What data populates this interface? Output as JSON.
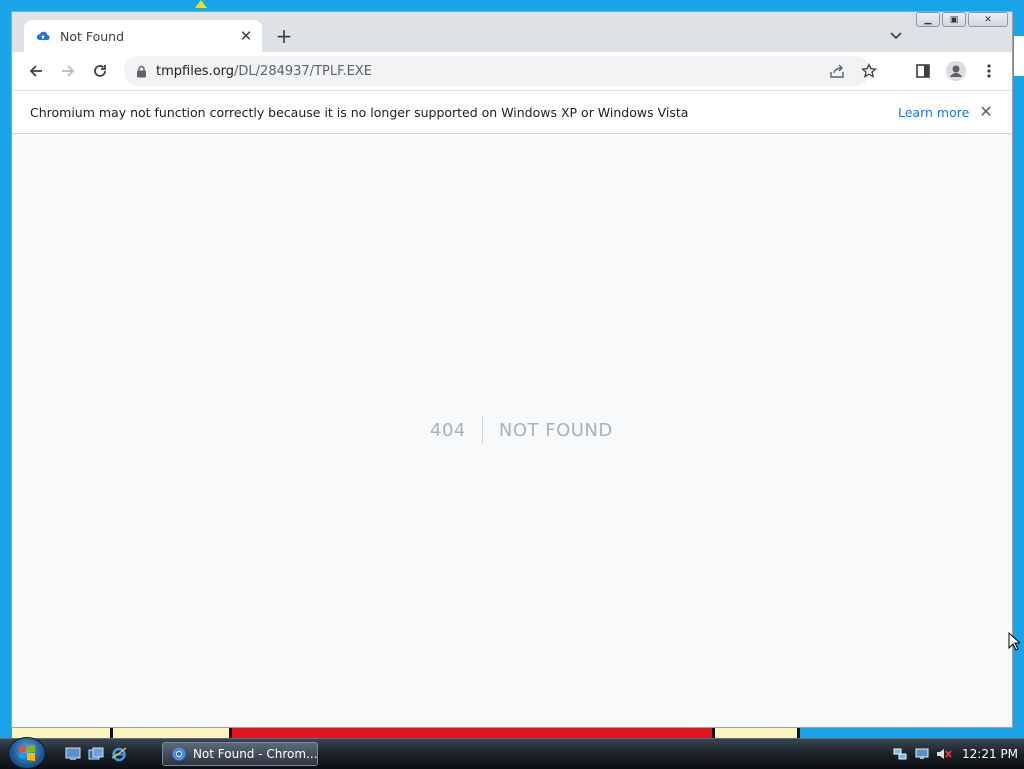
{
  "browser": {
    "tab": {
      "title": "Not Found"
    },
    "address_bar": {
      "domain": "tmpfiles.org",
      "path": "/DL/284937/TPLF.EXE"
    },
    "infobar": {
      "message": "Chromium may not function correctly because it is no longer supported on Windows XP or Windows Vista",
      "link": "Learn more"
    }
  },
  "page": {
    "error_code": "404",
    "error_text": "NOT FOUND"
  },
  "taskbar": {
    "task_label": "Not Found - Chrom...",
    "clock": "12:21 PM"
  },
  "colors": {
    "desktop": "#1aa3e6",
    "accent_link": "#1a73e8",
    "error_text": "#a8b2ba"
  }
}
